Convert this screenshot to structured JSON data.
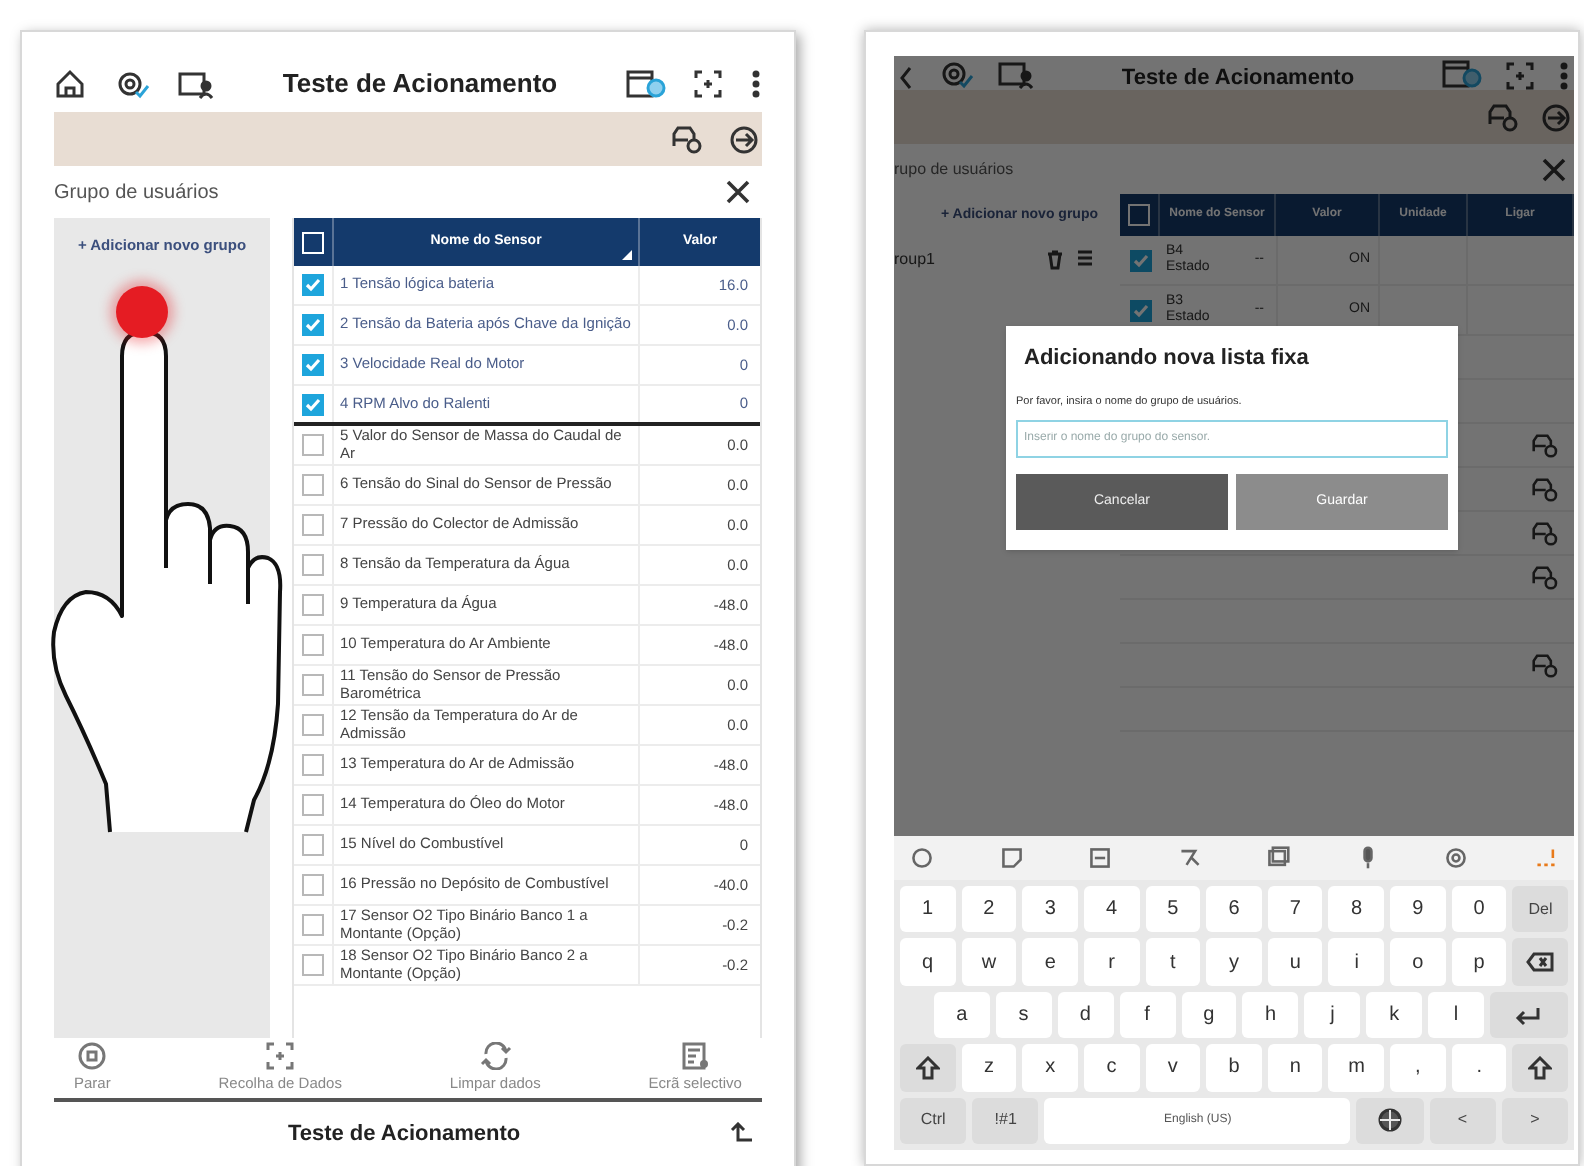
{
  "left_screen": {
    "title": "Teste de Acionamento",
    "panel_title": "Grupo de usuários",
    "add_group": "+ Adicionar novo grupo",
    "table": {
      "header_checked": false,
      "columns": [
        "Nome do Sensor",
        "Valor"
      ],
      "rows": [
        {
          "name": "1 Tensão lógica bateria",
          "value": "16.0",
          "checked": true
        },
        {
          "name": "2 Tensão da Bateria após Chave da Ignição",
          "value": "0.0",
          "checked": true
        },
        {
          "name": "3 Velocidade Real do Motor",
          "value": "0",
          "checked": true
        },
        {
          "name": "4 RPM Alvo do Ralenti",
          "value": "0",
          "checked": true
        },
        {
          "name": "5 Valor do Sensor de Massa do Caudal de Ar",
          "value": "0.0",
          "checked": false
        },
        {
          "name": "6 Tensão do Sinal do Sensor de Pressão",
          "value": "0.0",
          "checked": false
        },
        {
          "name": "7 Pressão do Colector de Admissão",
          "value": "0.0",
          "checked": false
        },
        {
          "name": "8 Tensão da Temperatura da Água",
          "value": "0.0",
          "checked": false
        },
        {
          "name": "9 Temperatura da Água",
          "value": "-48.0",
          "checked": false
        },
        {
          "name": "10 Temperatura do Ar Ambiente",
          "value": "-48.0",
          "checked": false
        },
        {
          "name": "11 Tensão do Sensor de Pressão Barométrica",
          "value": "0.0",
          "checked": false
        },
        {
          "name": "12 Tensão da Temperatura do Ar de Admissão",
          "value": "0.0",
          "checked": false
        },
        {
          "name": "13 Temperatura do Ar de Admissão",
          "value": "-48.0",
          "checked": false
        },
        {
          "name": "14 Temperatura do Óleo do Motor",
          "value": "-48.0",
          "checked": false
        },
        {
          "name": "15 Nível do Combustível",
          "value": "0",
          "checked": false
        },
        {
          "name": "16 Pressão no Depósito de Combustível",
          "value": "-40.0",
          "checked": false
        },
        {
          "name": "17 Sensor O2 Tipo Binário Banco 1 a Montante (Opção)",
          "value": "-0.2",
          "checked": false
        },
        {
          "name": "18 Sensor O2 Tipo Binário Banco 2 a Montante (Opção)",
          "value": "-0.2",
          "checked": false
        }
      ]
    },
    "toolbar": [
      {
        "label": "Parar"
      },
      {
        "label": "Recolha de Dados"
      },
      {
        "label": "Limpar dados"
      },
      {
        "label": "Ecrã selectivo"
      }
    ],
    "footer_title": "Teste de Acionamento"
  },
  "right_screen": {
    "title": "Teste de Acionamento",
    "panel_title": "rupo de usuários",
    "add_group": "+ Adicionar novo grupo",
    "groups": [
      "roup1"
    ],
    "table": {
      "header_checked": false,
      "columns": [
        "Nome do Sensor",
        "Valor",
        "Unidade",
        "Ligar"
      ],
      "rows": [
        {
          "name": "B4 Estado",
          "column_2": "--",
          "value": "ON",
          "checked": true
        },
        {
          "name": "B3 Estado",
          "column_2": "--",
          "value": "ON",
          "checked": true
        }
      ]
    },
    "dialog": {
      "title": "Adicionando nova lista fixa",
      "message": "Por favor, insira o nome do grupo de usuários.",
      "placeholder": "Inserir o nome do grupo do sensor.",
      "buttons": [
        {
          "label": "Cancelar",
          "disabled": false
        },
        {
          "label": "Guardar",
          "disabled": true
        }
      ]
    },
    "keyboard": {
      "rows": [
        {
          "keys": [
            {
              "kind": "char",
              "label": "1"
            },
            {
              "kind": "char",
              "label": "2"
            },
            {
              "kind": "char",
              "label": "3"
            },
            {
              "kind": "char",
              "label": "4"
            },
            {
              "kind": "char",
              "label": "5"
            },
            {
              "kind": "char",
              "label": "6"
            },
            {
              "kind": "char",
              "label": "7"
            },
            {
              "kind": "char",
              "label": "8"
            },
            {
              "kind": "char",
              "label": "9"
            },
            {
              "kind": "char",
              "label": "0"
            },
            {
              "kind": "func",
              "label": "Del"
            }
          ]
        },
        {
          "keys": [
            {
              "kind": "char",
              "label": "q"
            },
            {
              "kind": "char",
              "label": "w"
            },
            {
              "kind": "char",
              "label": "e"
            },
            {
              "kind": "char",
              "label": "r"
            },
            {
              "kind": "char",
              "label": "t"
            },
            {
              "kind": "char",
              "label": "y"
            },
            {
              "kind": "char",
              "label": "u"
            },
            {
              "kind": "char",
              "label": "i"
            },
            {
              "kind": "char",
              "label": "o"
            },
            {
              "kind": "char",
              "label": "p"
            },
            {
              "kind": "backspace"
            }
          ]
        },
        {
          "keys": [
            {
              "kind": "gap"
            },
            {
              "kind": "char",
              "label": "a"
            },
            {
              "kind": "char",
              "label": "s"
            },
            {
              "kind": "char",
              "label": "d"
            },
            {
              "kind": "char",
              "label": "f"
            },
            {
              "kind": "char",
              "label": "g"
            },
            {
              "kind": "char",
              "label": "h"
            },
            {
              "kind": "char",
              "label": "j"
            },
            {
              "kind": "char",
              "label": "k"
            },
            {
              "kind": "char",
              "label": "l"
            },
            {
              "kind": "enter"
            }
          ]
        },
        {
          "keys": [
            {
              "kind": "shift"
            },
            {
              "kind": "char",
              "label": "z"
            },
            {
              "kind": "char",
              "label": "x"
            },
            {
              "kind": "char",
              "label": "c"
            },
            {
              "kind": "char",
              "label": "v"
            },
            {
              "kind": "char",
              "label": "b"
            },
            {
              "kind": "char",
              "label": "n"
            },
            {
              "kind": "char",
              "label": "m"
            },
            {
              "kind": "char",
              "label": ","
            },
            {
              "kind": "char",
              "label": "."
            },
            {
              "kind": "shift"
            }
          ]
        },
        {
          "keys": [
            {
              "kind": "func",
              "label": "Ctrl"
            },
            {
              "kind": "func",
              "label": "!#1"
            },
            {
              "kind": "space",
              "label": "English (US)"
            },
            {
              "kind": "globe"
            },
            {
              "kind": "func",
              "label": "<"
            },
            {
              "kind": "func",
              "label": ">"
            }
          ]
        }
      ]
    }
  }
}
